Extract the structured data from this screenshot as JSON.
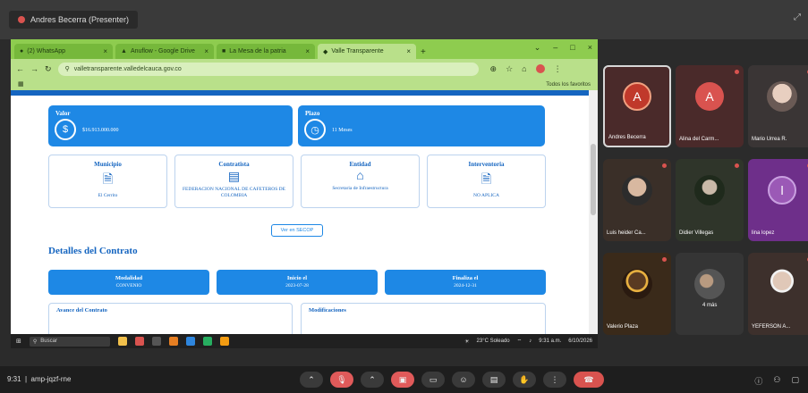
{
  "meeting": {
    "presenter_label": "Andres Becerra (Presenter)",
    "clock": "9:31",
    "meeting_code": "amp-jqzf-rne"
  },
  "browser": {
    "tabs": [
      {
        "label": "(2) WhatsApp"
      },
      {
        "label": "Anuflow - Google Drive"
      },
      {
        "label": "La Mesa de la patria"
      },
      {
        "label": "Valle Transparente"
      }
    ],
    "url": "valletransparente.valledelcauca.gov.co",
    "bookmarks_label": "Todos los favoritos"
  },
  "page": {
    "valor": {
      "title": "Valor",
      "value": "$16.913.000.000"
    },
    "plazo": {
      "title": "Plazo",
      "value": "11 Meses"
    },
    "municipio": {
      "title": "Municipio",
      "value": "El Cerrito"
    },
    "contratista": {
      "title": "Contratista",
      "value": "FEDERACION NACIONAL DE CAFETEROS DE COLOMBIA"
    },
    "entidad": {
      "title": "Entidad",
      "value": "Secretaria de Infraestructura"
    },
    "interventoria": {
      "title": "Interventoria",
      "value": "NO APLICA"
    },
    "ver_button": "Ver en SECOP",
    "details_title": "Detalles del Contrato",
    "modalidad": {
      "title": "Modalidad",
      "value": "CONVENIO"
    },
    "inicio": {
      "title": "Inicio el",
      "value": "2023-07-28"
    },
    "finaliza": {
      "title": "Finaliza el",
      "value": "2024-12-31"
    },
    "avance_title": "Avance del Contrato",
    "modificaciones_title": "Modificaciones"
  },
  "taskbar": {
    "search_label": "Buscar",
    "weather": "23°C Soleado",
    "time": "9:31 a.m.",
    "date": "6/10/2026"
  },
  "participants": [
    {
      "name": "Andres Becerra",
      "initial": "A",
      "color": "#c0392b"
    },
    {
      "name": "Alina del Carm...",
      "initial": "A",
      "color": "#d9534f"
    },
    {
      "name": "Mario Urrea R.",
      "initial": "",
      "color": "#5a4a48"
    },
    {
      "name": "Luis heider Ca...",
      "initial": "",
      "color": "#4b3a2e"
    },
    {
      "name": "Didier Villegas",
      "initial": "",
      "color": "#3b4a34"
    },
    {
      "name": "lina lopez",
      "initial": "l",
      "color": "#9b59b6"
    },
    {
      "name": "Valerio Plaza",
      "initial": "",
      "color": "#6a4a2e"
    },
    {
      "name": "4 más",
      "initial": "",
      "color": "#4a4a4a"
    },
    {
      "name": "YEFERSON A...",
      "initial": "",
      "color": "#5e4a44"
    }
  ]
}
